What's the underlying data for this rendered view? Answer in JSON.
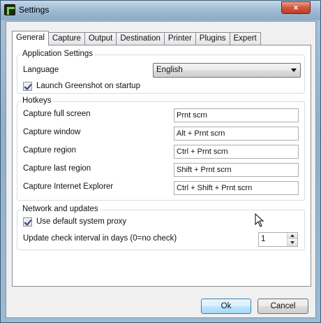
{
  "window": {
    "title": "Settings",
    "close_glyph": "×"
  },
  "tabs": [
    {
      "label": "General",
      "active": true
    },
    {
      "label": "Capture",
      "active": false
    },
    {
      "label": "Output",
      "active": false
    },
    {
      "label": "Destination",
      "active": false
    },
    {
      "label": "Printer",
      "active": false
    },
    {
      "label": "Plugins",
      "active": false
    },
    {
      "label": "Expert",
      "active": false
    }
  ],
  "application_settings": {
    "title": "Application Settings",
    "language_label": "Language",
    "language_value": "English",
    "launch_on_startup_label": "Launch Greenshot on startup",
    "launch_on_startup_checked": true
  },
  "hotkeys": {
    "title": "Hotkeys",
    "items": [
      {
        "label": "Capture full screen",
        "value": "Prnt scrn"
      },
      {
        "label": "Capture window",
        "value": "Alt + Prnt scrn"
      },
      {
        "label": "Capture region",
        "value": "Ctrl + Prnt scrn"
      },
      {
        "label": "Capture last region",
        "value": "Shift + Prnt scrn"
      },
      {
        "label": "Capture Internet Explorer",
        "value": "Ctrl + Shift + Prnt scrn"
      }
    ]
  },
  "network": {
    "title": "Network and updates",
    "proxy_label": "Use default system proxy",
    "proxy_checked": true,
    "interval_label": "Update check interval in days (0=no check)",
    "interval_value": "1"
  },
  "buttons": {
    "ok": "Ok",
    "cancel": "Cancel"
  }
}
